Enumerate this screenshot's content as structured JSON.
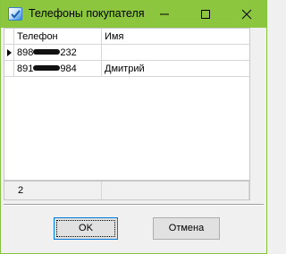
{
  "window": {
    "title": "Телефоны покупателя",
    "accent_color": "#8cc63f"
  },
  "grid": {
    "columns": [
      "Телефон",
      "Имя"
    ],
    "rows": [
      {
        "phone_visible": "898",
        "phone_end": "232",
        "name": "",
        "selected": true
      },
      {
        "phone_visible": "891",
        "phone_end": "984",
        "name": "Дмитрий",
        "selected": false
      }
    ],
    "footer": {
      "count": "2",
      "name": ""
    }
  },
  "buttons": {
    "ok": "OK",
    "cancel": "Отмена"
  },
  "icons": {
    "app": "checkbox-app-icon",
    "minimize": "minimize-icon",
    "maximize": "maximize-icon",
    "close": "close-icon",
    "row_selector": "row-pointer-icon"
  }
}
